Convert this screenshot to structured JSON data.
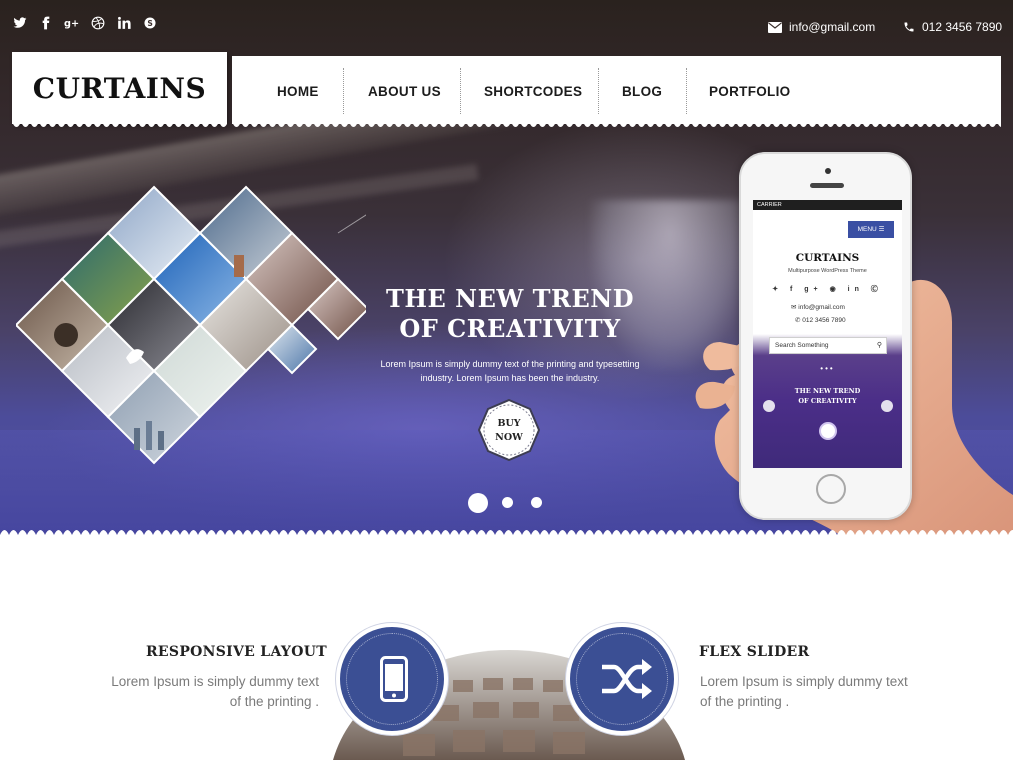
{
  "topbar": {
    "social_icons": [
      "twitter-icon",
      "facebook-icon",
      "google-plus-icon",
      "dribbble-icon",
      "linkedin-icon",
      "skype-icon"
    ],
    "email": "info@gmail.com",
    "phone": "012 3456 7890"
  },
  "header": {
    "logo": "CURTAINS",
    "nav": [
      "HOME",
      "ABOUT US",
      "SHORTCODES",
      "BLOG",
      "PORTFOLIO"
    ]
  },
  "hero": {
    "title_line1": "THE NEW TREND",
    "title_line2": "OF CREATIVITY",
    "text": "Lorem Ipsum is simply dummy text of the printing and typesetting industry. Lorem Ipsum has been the industry.",
    "button_line1": "BUY",
    "button_line2": "NOW",
    "slides": 3,
    "active_slide": 1
  },
  "phone_mockup": {
    "carrier": "CARRIER",
    "menu_label": "MENU",
    "logo": "CURTAINS",
    "tagline": "Multipurpose WordPress Theme",
    "email": "info@gmail.com",
    "phone": "012 3456 7890",
    "search_placeholder": "Search Something",
    "title_line1": "THE NEW  TREND",
    "title_line2": "OF CREATIVITY"
  },
  "features": [
    {
      "title": "RESPONSIVE LAYOUT",
      "text_line1": "Lorem Ipsum is simply dummy text",
      "text_line2": "of the printing .",
      "icon": "mobile-phone-icon"
    },
    {
      "title": "FLEX SLIDER",
      "text_line1": "Lorem Ipsum is simply dummy text",
      "text_line2": "of the printing .",
      "icon": "shuffle-icon"
    }
  ],
  "colors": {
    "accent": "#3b4f94",
    "nav_text": "#1c1c1c",
    "body_text": "#7a7a7a"
  }
}
